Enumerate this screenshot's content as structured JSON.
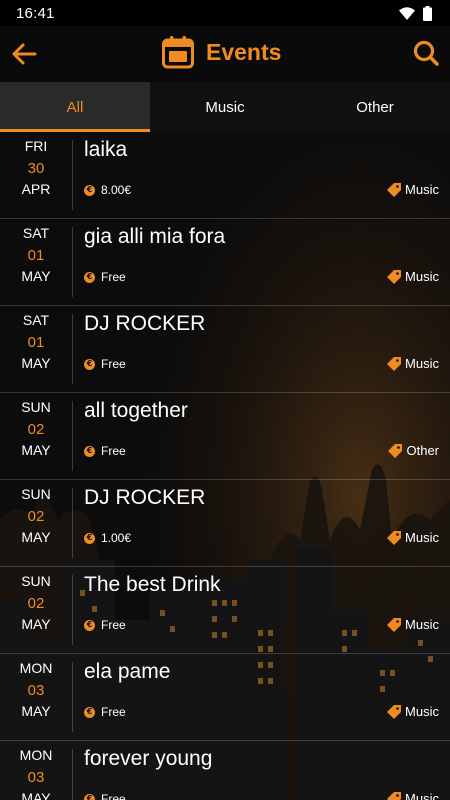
{
  "status_bar": {
    "time": "16:41"
  },
  "app_bar": {
    "title": "Events"
  },
  "tabs": [
    {
      "label": "All",
      "active": true
    },
    {
      "label": "Music",
      "active": false
    },
    {
      "label": "Other",
      "active": false
    }
  ],
  "events": [
    {
      "dow": "FRI",
      "day": "30",
      "month": "APR",
      "title": "laika",
      "price": "8.00€",
      "category": "Music"
    },
    {
      "dow": "SAT",
      "day": "01",
      "month": "MAY",
      "title": "gia alli mia fora",
      "price": "Free",
      "category": "Music"
    },
    {
      "dow": "SAT",
      "day": "01",
      "month": "MAY",
      "title": "DJ ROCKER",
      "price": "Free",
      "category": "Music"
    },
    {
      "dow": "SUN",
      "day": "02",
      "month": "MAY",
      "title": "all together",
      "price": "Free",
      "category": "Other"
    },
    {
      "dow": "SUN",
      "day": "02",
      "month": "MAY",
      "title": "DJ ROCKER",
      "price": "1.00€",
      "category": "Music"
    },
    {
      "dow": "SUN",
      "day": "02",
      "month": "MAY",
      "title": "The best Drink",
      "price": "Free",
      "category": "Music"
    },
    {
      "dow": "MON",
      "day": "03",
      "month": "MAY",
      "title": "ela pame",
      "price": "Free",
      "category": "Music"
    },
    {
      "dow": "MON",
      "day": "03",
      "month": "MAY",
      "title": "forever young",
      "price": "Free",
      "category": "Music"
    }
  ],
  "icons": {
    "back": "arrow-left-icon",
    "calendar": "calendar-icon",
    "search": "search-icon",
    "price": "euro-coin-icon",
    "category": "tag-icon"
  },
  "colors": {
    "accent": "#f08a24",
    "background": "#0c0c0c",
    "text": "#ffffff"
  }
}
